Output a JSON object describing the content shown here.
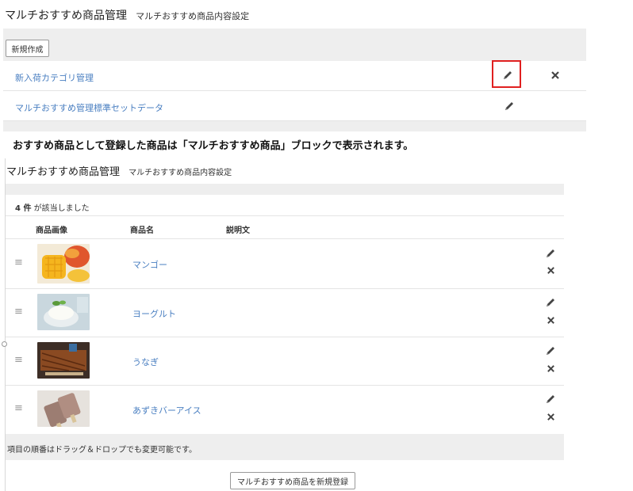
{
  "top": {
    "title": "マルチおすすめ商品管理",
    "subtitle": "マルチおすすめ商品内容設定",
    "new_button": "新規作成",
    "rows": [
      {
        "label": "新入荷カテゴリ管理",
        "has_delete": true
      },
      {
        "label": "マルチおすすめ管理標準セットデータ",
        "has_delete": false
      }
    ]
  },
  "caption": "おすすめ商品として登録した商品は「マルチおすすめ商品」ブロックで表示されます。",
  "bottom": {
    "title": "マルチおすすめ商品管理",
    "subtitle": "マルチおすすめ商品内容設定",
    "count_number": "4 件",
    "count_suffix": " が該当しました",
    "columns": [
      "商品画像",
      "商品名",
      "説明文"
    ],
    "products": [
      {
        "name": "マンゴー"
      },
      {
        "name": "ヨーグルト"
      },
      {
        "name": "うなぎ"
      },
      {
        "name": "あずきバーアイス"
      }
    ],
    "footer_note": "項目の順番はドラッグ＆ドロップでも変更可能です。",
    "register_button": "マルチおすすめ商品を新規登録"
  },
  "icons": {
    "edit": "pencil-icon",
    "delete": "close-icon",
    "drag": "drag-handle-icon"
  },
  "colors": {
    "link": "#4a7fc1",
    "highlight_border": "#e02020",
    "band": "#eeeeee"
  }
}
